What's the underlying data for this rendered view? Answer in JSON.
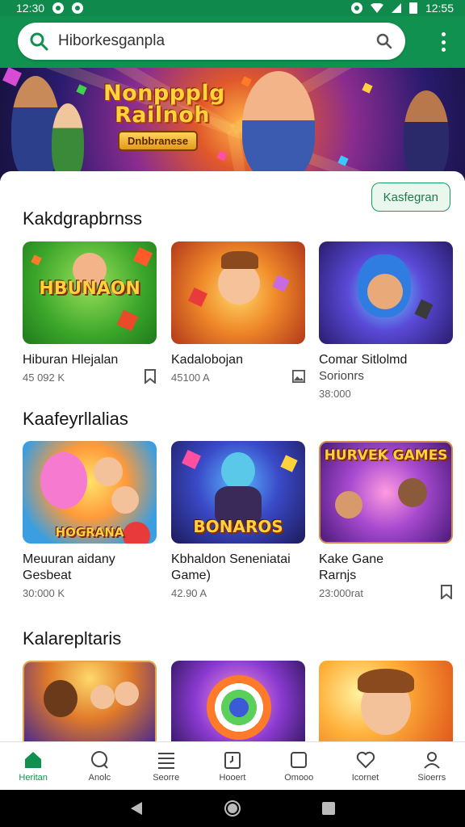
{
  "status": {
    "time": "12:30",
    "right_text": "12:55"
  },
  "search": {
    "value": "Hiborkesganpla"
  },
  "banner": {
    "title_line1": "Nonppplg",
    "title_line2": "Railnoh",
    "badge": "Dnbbranese"
  },
  "top_button": {
    "label": "Kasfegran"
  },
  "sections": [
    {
      "title": "Kakdgrapbrnss",
      "cards": [
        {
          "title": "Hiburan Hlejalan",
          "title2": "",
          "meta": "45 092 K",
          "thumb_text": "HBUNAON",
          "icon": "bookmark-icon"
        },
        {
          "title": "Kadalobojan",
          "title2": "",
          "meta": "45100 A",
          "thumb_text": "",
          "icon": "image-icon"
        },
        {
          "title": "Comar Sitlolmd",
          "title2": "Sorionrs",
          "meta": "38:000",
          "thumb_text": "",
          "icon": ""
        }
      ]
    },
    {
      "title": "Kaafeyrllalias",
      "cards": [
        {
          "title": "Meuuran aidany",
          "title2": "Gesbeat",
          "meta": "30:000 K",
          "thumb_text": "HOGRANA",
          "icon": ""
        },
        {
          "title": "Kbhaldon Seneniatai",
          "title2": "Game)",
          "meta": "42.90 A",
          "thumb_text": "BONAROS",
          "icon": ""
        },
        {
          "title": "Kake Gane",
          "title2": "Rarnjs",
          "meta": "23:000rat",
          "thumb_text": "HURVEK GAMES",
          "icon": "bookmark-icon"
        }
      ]
    },
    {
      "title": "Kalarepltaris",
      "cards": [
        {},
        {},
        {}
      ]
    }
  ],
  "nav": [
    {
      "label": "Heritan",
      "icon": "home-icon",
      "active": true
    },
    {
      "label": "Anolc",
      "icon": "chat-icon",
      "active": false
    },
    {
      "label": "Seorre",
      "icon": "list-icon",
      "active": false
    },
    {
      "label": "Hooert",
      "icon": "clock-icon",
      "active": false
    },
    {
      "label": "Omooo",
      "icon": "square-icon",
      "active": false
    },
    {
      "label": "Icornet",
      "icon": "heart-icon",
      "active": false
    },
    {
      "label": "Sioerrs",
      "icon": "profile-icon",
      "active": false
    }
  ],
  "colors": {
    "brand": "#11914f",
    "accent_light": "#eaf7ef"
  }
}
